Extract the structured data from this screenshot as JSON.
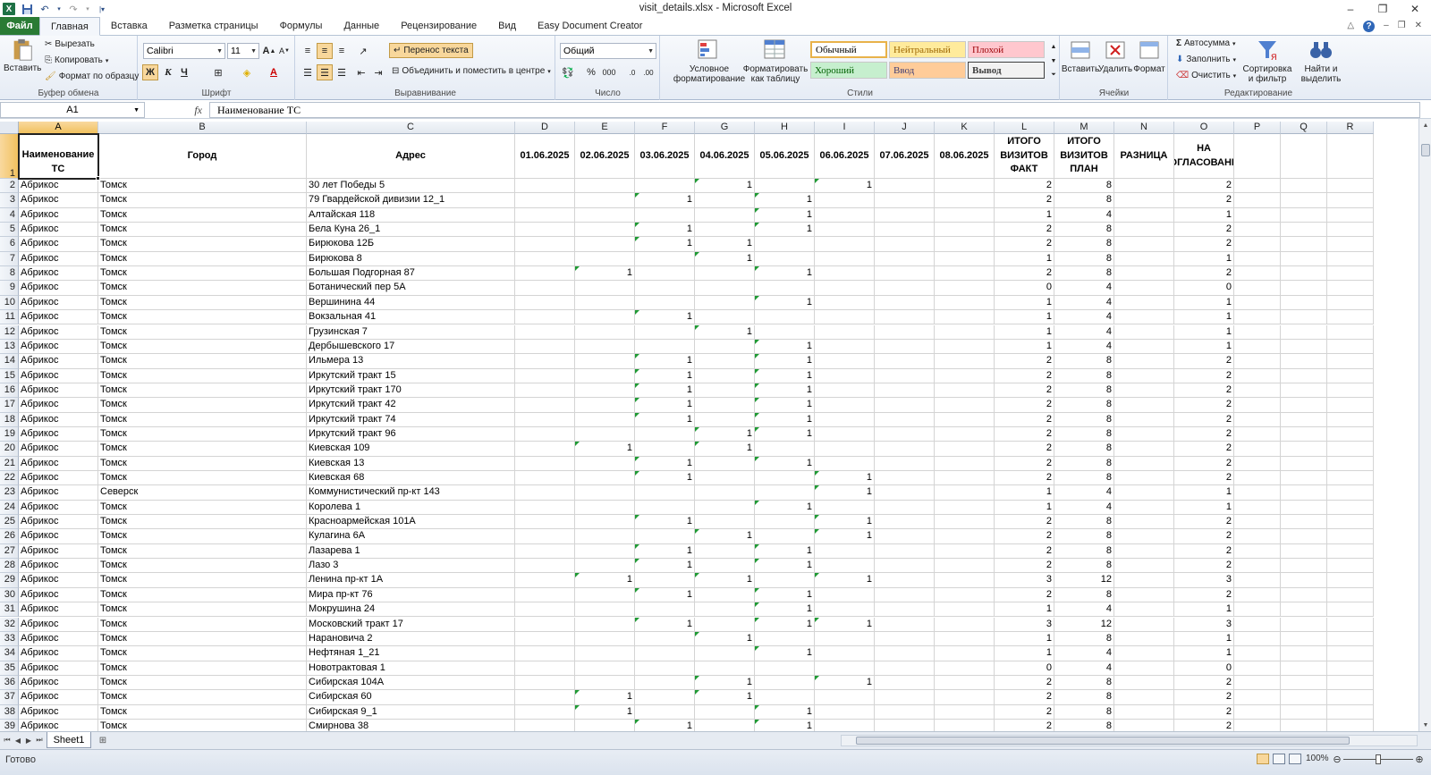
{
  "window": {
    "title": "visit_details.xlsx  -  Microsoft Excel",
    "minimize": "–",
    "restore": "❐",
    "close": "✕"
  },
  "tabs": [
    "Файл",
    "Главная",
    "Вставка",
    "Разметка страницы",
    "Формулы",
    "Данные",
    "Рецензирование",
    "Вид",
    "Easy Document Creator"
  ],
  "ribbon": {
    "clipboard": {
      "label": "Буфер обмена",
      "paste": "Вставить",
      "cut": "Вырезать",
      "copy": "Копировать",
      "format_painter": "Формат по образцу"
    },
    "font": {
      "label": "Шрифт",
      "name": "Calibri",
      "size": "11",
      "bold": "Ж",
      "italic": "К",
      "underline": "Ч"
    },
    "alignment": {
      "label": "Выравнивание",
      "wrap": "Перенос текста",
      "merge": "Объединить и поместить в центре"
    },
    "number": {
      "label": "Число",
      "format": "Общий",
      "percent": "%",
      "thousands": "000"
    },
    "styles": {
      "label": "Стили",
      "conditional": "Условное форматирование",
      "as_table": "Форматировать как таблицу",
      "normal": "Обычный",
      "neutral": "Нейтральный",
      "bad": "Плохой",
      "good": "Хороший",
      "input": "Ввод",
      "output": "Вывод"
    },
    "cells": {
      "label": "Ячейки",
      "insert": "Вставить",
      "delete": "Удалить",
      "format": "Формат"
    },
    "editing": {
      "label": "Редактирование",
      "autosum": "Автосумма",
      "fill": "Заполнить",
      "clear": "Очистить",
      "sort": "Сортировка и фильтр",
      "find": "Найти и выделить"
    }
  },
  "formula_bar": {
    "name_box": "A1",
    "fx": "fx",
    "value": "Наименование ТС"
  },
  "columns": [
    "A",
    "B",
    "C",
    "D",
    "E",
    "F",
    "G",
    "H",
    "I",
    "J",
    "K",
    "L",
    "M",
    "N",
    "O",
    "P",
    "Q",
    "R"
  ],
  "header_row": [
    "Наименование ТС",
    "Город",
    "Адрес",
    "01.06.2025",
    "02.06.2025",
    "03.06.2025",
    "04.06.2025",
    "05.06.2025",
    "06.06.2025",
    "07.06.2025",
    "08.06.2025",
    "ИТОГО ВИЗИТОВ ФАКТ",
    "ИТОГО ВИЗИТОВ ПЛАН",
    "РАЗНИЦА",
    "НА СОГЛАСОВАНИЕ"
  ],
  "rows": [
    [
      "Абрикос",
      "Томск",
      "30 лет Победы 5",
      "",
      "",
      "",
      "1",
      "",
      "1",
      "",
      "",
      "2",
      "8",
      "",
      "2"
    ],
    [
      "Абрикос",
      "Томск",
      "79 Гвардейской дивизии 12_1",
      "",
      "",
      "1",
      "",
      "1",
      "",
      "",
      "",
      "2",
      "8",
      "",
      "2"
    ],
    [
      "Абрикос",
      "Томск",
      "Алтайская 118",
      "",
      "",
      "",
      "",
      "1",
      "",
      "",
      "",
      "1",
      "4",
      "",
      "1"
    ],
    [
      "Абрикос",
      "Томск",
      "Бела Куна 26_1",
      "",
      "",
      "1",
      "",
      "1",
      "",
      "",
      "",
      "2",
      "8",
      "",
      "2"
    ],
    [
      "Абрикос",
      "Томск",
      "Бирюкова 12Б",
      "",
      "",
      "1",
      "1",
      "",
      "",
      "",
      "",
      "2",
      "8",
      "",
      "2"
    ],
    [
      "Абрикос",
      "Томск",
      "Бирюкова 8",
      "",
      "",
      "",
      "1",
      "",
      "",
      "",
      "",
      "1",
      "8",
      "",
      "1"
    ],
    [
      "Абрикос",
      "Томск",
      "Большая Подгорная 87",
      "",
      "1",
      "",
      "",
      "1",
      "",
      "",
      "",
      "2",
      "8",
      "",
      "2"
    ],
    [
      "Абрикос",
      "Томск",
      "Ботанический пер 5А",
      "",
      "",
      "",
      "",
      "",
      "",
      "",
      "",
      "0",
      "4",
      "",
      "0"
    ],
    [
      "Абрикос",
      "Томск",
      "Вершинина 44",
      "",
      "",
      "",
      "",
      "1",
      "",
      "",
      "",
      "1",
      "4",
      "",
      "1"
    ],
    [
      "Абрикос",
      "Томск",
      "Вокзальная 41",
      "",
      "",
      "1",
      "",
      "",
      "",
      "",
      "",
      "1",
      "4",
      "",
      "1"
    ],
    [
      "Абрикос",
      "Томск",
      "Грузинская 7",
      "",
      "",
      "",
      "1",
      "",
      "",
      "",
      "",
      "1",
      "4",
      "",
      "1"
    ],
    [
      "Абрикос",
      "Томск",
      "Дербышевского 17",
      "",
      "",
      "",
      "",
      "1",
      "",
      "",
      "",
      "1",
      "4",
      "",
      "1"
    ],
    [
      "Абрикос",
      "Томск",
      "Ильмера 13",
      "",
      "",
      "1",
      "",
      "1",
      "",
      "",
      "",
      "2",
      "8",
      "",
      "2"
    ],
    [
      "Абрикос",
      "Томск",
      "Иркутский тракт 15",
      "",
      "",
      "1",
      "",
      "1",
      "",
      "",
      "",
      "2",
      "8",
      "",
      "2"
    ],
    [
      "Абрикос",
      "Томск",
      "Иркутский тракт 170",
      "",
      "",
      "1",
      "",
      "1",
      "",
      "",
      "",
      "2",
      "8",
      "",
      "2"
    ],
    [
      "Абрикос",
      "Томск",
      "Иркутский тракт 42",
      "",
      "",
      "1",
      "",
      "1",
      "",
      "",
      "",
      "2",
      "8",
      "",
      "2"
    ],
    [
      "Абрикос",
      "Томск",
      "Иркутский тракт 74",
      "",
      "",
      "1",
      "",
      "1",
      "",
      "",
      "",
      "2",
      "8",
      "",
      "2"
    ],
    [
      "Абрикос",
      "Томск",
      "Иркутский тракт 96",
      "",
      "",
      "",
      "1",
      "1",
      "",
      "",
      "",
      "2",
      "8",
      "",
      "2"
    ],
    [
      "Абрикос",
      "Томск",
      "Киевская 109",
      "",
      "1",
      "",
      "1",
      "",
      "",
      "",
      "",
      "2",
      "8",
      "",
      "2"
    ],
    [
      "Абрикос",
      "Томск",
      "Киевская 13",
      "",
      "",
      "1",
      "",
      "1",
      "",
      "",
      "",
      "2",
      "8",
      "",
      "2"
    ],
    [
      "Абрикос",
      "Томск",
      "Киевская 68",
      "",
      "",
      "1",
      "",
      "",
      "1",
      "",
      "",
      "2",
      "8",
      "",
      "2"
    ],
    [
      "Абрикос",
      "Северск",
      "Коммунистический пр-кт 143",
      "",
      "",
      "",
      "",
      "",
      "1",
      "",
      "",
      "1",
      "4",
      "",
      "1"
    ],
    [
      "Абрикос",
      "Томск",
      "Королева 1",
      "",
      "",
      "",
      "",
      "1",
      "",
      "",
      "",
      "1",
      "4",
      "",
      "1"
    ],
    [
      "Абрикос",
      "Томск",
      "Красноармейская 101А",
      "",
      "",
      "1",
      "",
      "",
      "1",
      "",
      "",
      "2",
      "8",
      "",
      "2"
    ],
    [
      "Абрикос",
      "Томск",
      "Кулагина 6А",
      "",
      "",
      "",
      "1",
      "",
      "1",
      "",
      "",
      "2",
      "8",
      "",
      "2"
    ],
    [
      "Абрикос",
      "Томск",
      "Лазарева 1",
      "",
      "",
      "1",
      "",
      "1",
      "",
      "",
      "",
      "2",
      "8",
      "",
      "2"
    ],
    [
      "Абрикос",
      "Томск",
      "Лазо 3",
      "",
      "",
      "1",
      "",
      "1",
      "",
      "",
      "",
      "2",
      "8",
      "",
      "2"
    ],
    [
      "Абрикос",
      "Томск",
      "Ленина пр-кт 1А",
      "",
      "1",
      "",
      "1",
      "",
      "1",
      "",
      "",
      "3",
      "12",
      "",
      "3"
    ],
    [
      "Абрикос",
      "Томск",
      "Мира пр-кт 76",
      "",
      "",
      "1",
      "",
      "1",
      "",
      "",
      "",
      "2",
      "8",
      "",
      "2"
    ],
    [
      "Абрикос",
      "Томск",
      "Мокрушина 24",
      "",
      "",
      "",
      "",
      "1",
      "",
      "",
      "",
      "1",
      "4",
      "",
      "1"
    ],
    [
      "Абрикос",
      "Томск",
      "Московский тракт 17",
      "",
      "",
      "1",
      "",
      "1",
      "1",
      "",
      "",
      "3",
      "12",
      "",
      "3"
    ],
    [
      "Абрикос",
      "Томск",
      "Нарановича 2",
      "",
      "",
      "",
      "1",
      "",
      "",
      "",
      "",
      "1",
      "8",
      "",
      "1"
    ],
    [
      "Абрикос",
      "Томск",
      "Нефтяная 1_21",
      "",
      "",
      "",
      "",
      "1",
      "",
      "",
      "",
      "1",
      "4",
      "",
      "1"
    ],
    [
      "Абрикос",
      "Томск",
      "Новотрактовая 1",
      "",
      "",
      "",
      "",
      "",
      "",
      "",
      "",
      "0",
      "4",
      "",
      "0"
    ],
    [
      "Абрикос",
      "Томск",
      "Сибирская 104А",
      "",
      "",
      "",
      "1",
      "",
      "1",
      "",
      "",
      "2",
      "8",
      "",
      "2"
    ],
    [
      "Абрикос",
      "Томск",
      "Сибирская 60",
      "",
      "1",
      "",
      "1",
      "",
      "",
      "",
      "",
      "2",
      "8",
      "",
      "2"
    ],
    [
      "Абрикос",
      "Томск",
      "Сибирская 9_1",
      "",
      "1",
      "",
      "",
      "1",
      "",
      "",
      "",
      "2",
      "8",
      "",
      "2"
    ],
    [
      "Абрикос",
      "Томск",
      "Смирнова 38",
      "",
      "",
      "1",
      "",
      "1",
      "",
      "",
      "",
      "2",
      "8",
      "",
      "2"
    ]
  ],
  "green_triangles": [
    [
      2,
      6
    ],
    [
      2,
      8
    ],
    [
      3,
      5
    ],
    [
      3,
      7
    ],
    [
      4,
      7
    ],
    [
      5,
      5
    ],
    [
      5,
      7
    ],
    [
      6,
      5
    ],
    [
      7,
      6
    ],
    [
      8,
      4
    ],
    [
      8,
      7
    ],
    [
      10,
      7
    ],
    [
      11,
      5
    ],
    [
      12,
      6
    ],
    [
      13,
      7
    ],
    [
      14,
      5
    ],
    [
      14,
      7
    ],
    [
      15,
      5
    ],
    [
      15,
      7
    ],
    [
      16,
      5
    ],
    [
      16,
      7
    ],
    [
      17,
      5
    ],
    [
      17,
      7
    ],
    [
      18,
      5
    ],
    [
      18,
      7
    ],
    [
      19,
      6
    ],
    [
      19,
      7
    ],
    [
      20,
      4
    ],
    [
      20,
      6
    ],
    [
      21,
      5
    ],
    [
      21,
      7
    ],
    [
      22,
      5
    ],
    [
      22,
      8
    ],
    [
      23,
      8
    ],
    [
      24,
      7
    ],
    [
      25,
      5
    ],
    [
      25,
      8
    ],
    [
      26,
      6
    ],
    [
      26,
      8
    ],
    [
      27,
      5
    ],
    [
      27,
      7
    ],
    [
      28,
      5
    ],
    [
      28,
      7
    ],
    [
      29,
      4
    ],
    [
      29,
      6
    ],
    [
      29,
      8
    ],
    [
      30,
      5
    ],
    [
      30,
      7
    ],
    [
      31,
      7
    ],
    [
      32,
      5
    ],
    [
      32,
      7
    ],
    [
      32,
      8
    ],
    [
      33,
      6
    ],
    [
      34,
      7
    ],
    [
      36,
      6
    ],
    [
      36,
      8
    ],
    [
      37,
      4
    ],
    [
      37,
      6
    ],
    [
      38,
      4
    ],
    [
      38,
      7
    ],
    [
      39,
      5
    ],
    [
      39,
      7
    ]
  ],
  "sheet": {
    "name": "Sheet1"
  },
  "status": {
    "ready": "Готово",
    "zoom": "100%"
  }
}
